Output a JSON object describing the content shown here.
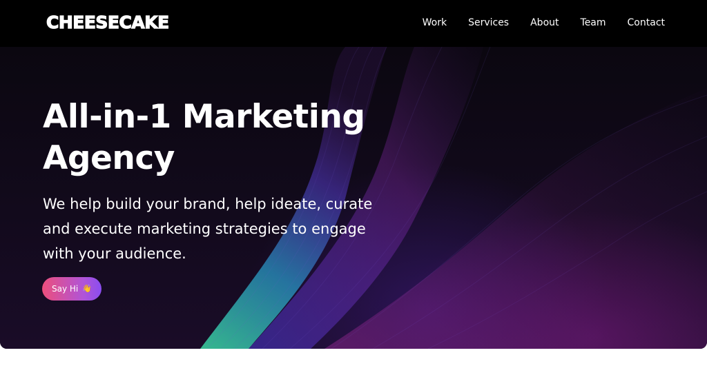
{
  "brand": {
    "logo_text": "CHEESECAKE"
  },
  "nav": {
    "items": [
      {
        "label": "Work"
      },
      {
        "label": "Services"
      },
      {
        "label": "About"
      },
      {
        "label": "Team"
      },
      {
        "label": "Contact"
      }
    ]
  },
  "hero": {
    "title": "All-in-1 Marketing Agency",
    "subtitle": "We help build your brand, help ideate, curate and execute marketing strategies to engage with your audience.",
    "cta_label": "Say Hi",
    "cta_icon": "waving-hand-icon"
  },
  "colors": {
    "nav_background": "#000000",
    "hero_background": "#0d0813",
    "cta_gradient_start": "#ec4f7c",
    "cta_gradient_end": "#8a4df0",
    "text": "#ffffff"
  }
}
